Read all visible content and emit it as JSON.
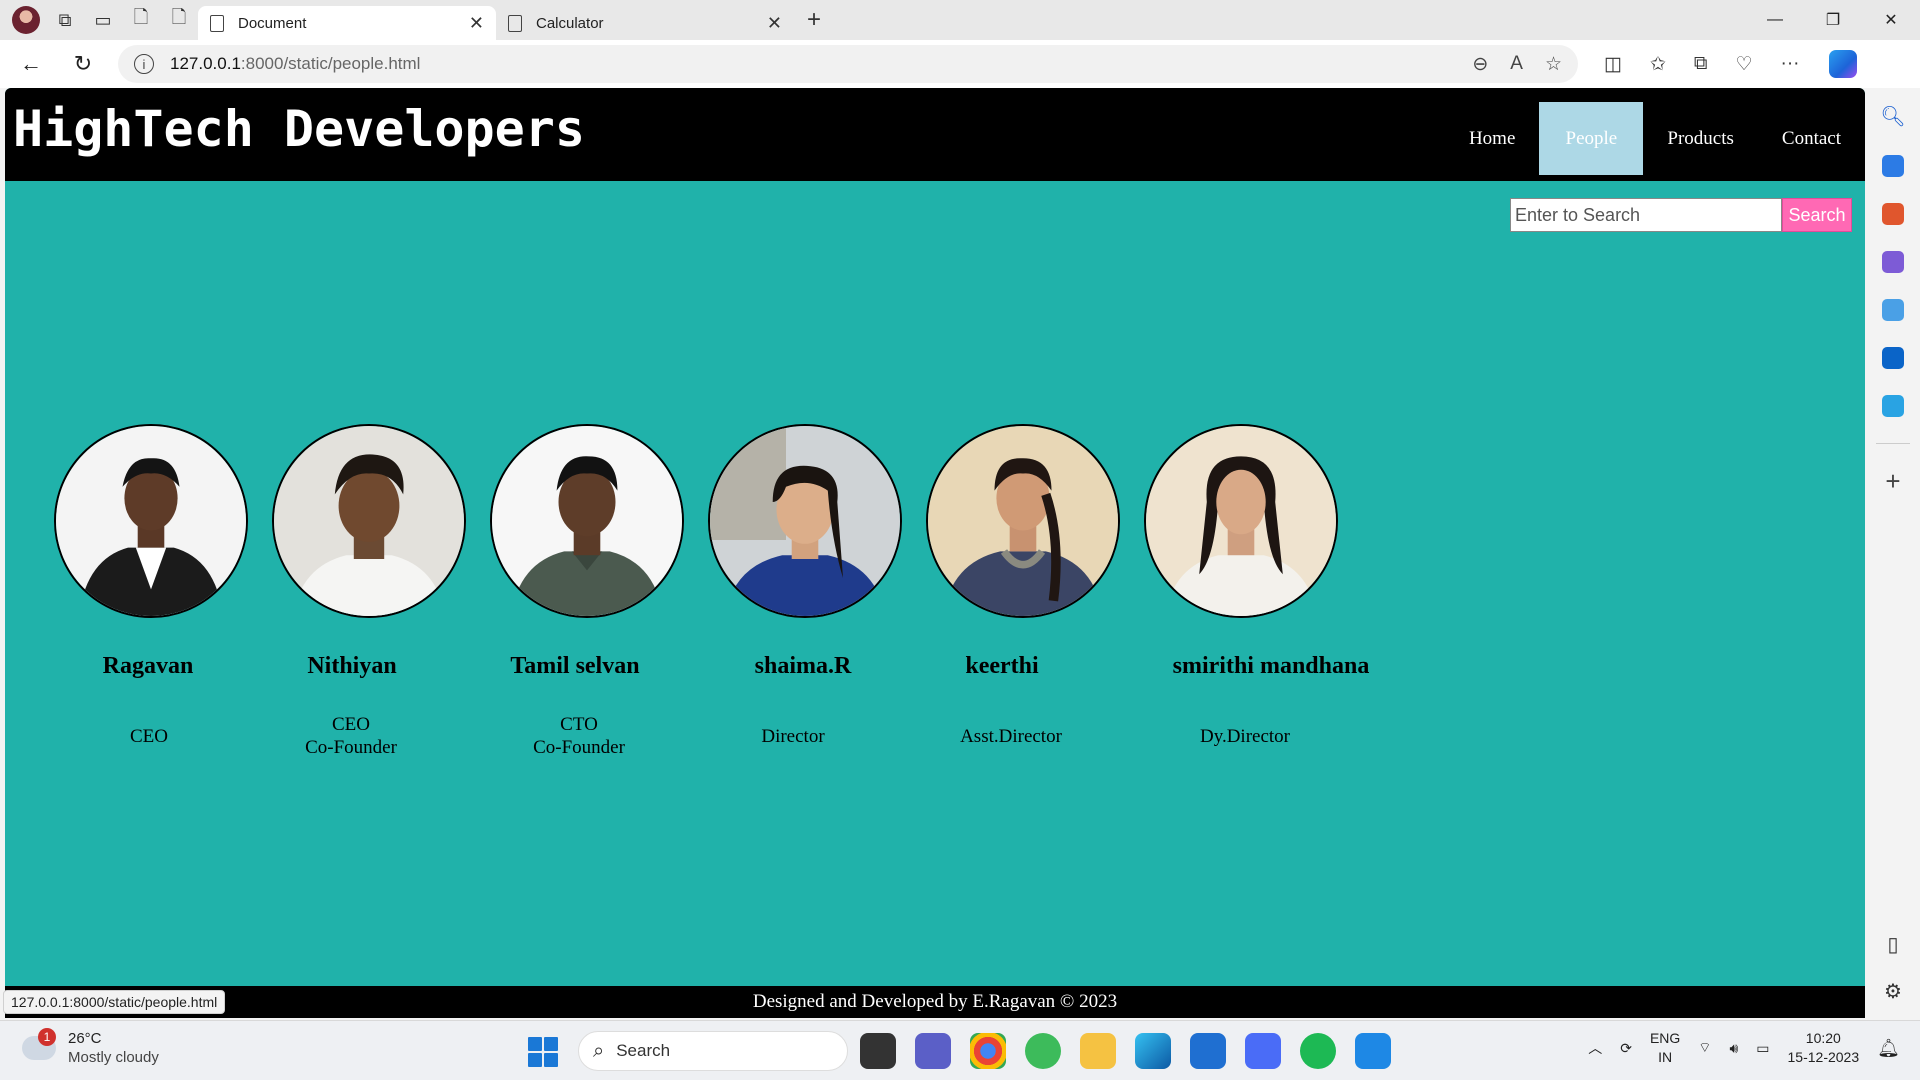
{
  "browser": {
    "tabs": [
      {
        "title": "Document",
        "active": true
      },
      {
        "title": "Calculator",
        "active": false
      }
    ],
    "url_host": "127.0.0.1",
    "url_path": ":8000/static/people.html",
    "status_url": "127.0.0.1:8000/static/people.html"
  },
  "site": {
    "title": "HighTech Developers",
    "nav": [
      {
        "label": "Home",
        "active": false
      },
      {
        "label": "People",
        "active": true
      },
      {
        "label": "Products",
        "active": false
      },
      {
        "label": "Contact",
        "active": false
      }
    ],
    "search": {
      "placeholder": "Enter to Search",
      "button_label": "Search"
    },
    "people": [
      {
        "name": "Ragavan",
        "role_line1": "CEO",
        "role_line2": ""
      },
      {
        "name": "Nithiyan",
        "role_line1": "CEO",
        "role_line2": "Co-Founder"
      },
      {
        "name": "Tamil selvan",
        "role_line1": "CTO",
        "role_line2": "Co-Founder"
      },
      {
        "name": "shaima.R",
        "role_line1": "Director",
        "role_line2": ""
      },
      {
        "name": "keerthi",
        "role_line1": "Asst.Director",
        "role_line2": ""
      },
      {
        "name": "smirithi mandhana",
        "role_line1": "Dy.Director",
        "role_line2": ""
      }
    ],
    "footer": "Designed and Developed by E.Ragavan © 2023"
  },
  "taskbar": {
    "weather_temp": "26°C",
    "weather_condition": "Mostly cloudy",
    "weather_badge": "1",
    "search_label": "Search",
    "lang_line1": "ENG",
    "lang_line2": "IN",
    "time": "10:20",
    "date": "15-12-2023"
  },
  "colors": {
    "page_background": "#20b2aa",
    "header_background": "#000000",
    "active_nav": "#add8e6",
    "search_button": "#ff69b4"
  }
}
